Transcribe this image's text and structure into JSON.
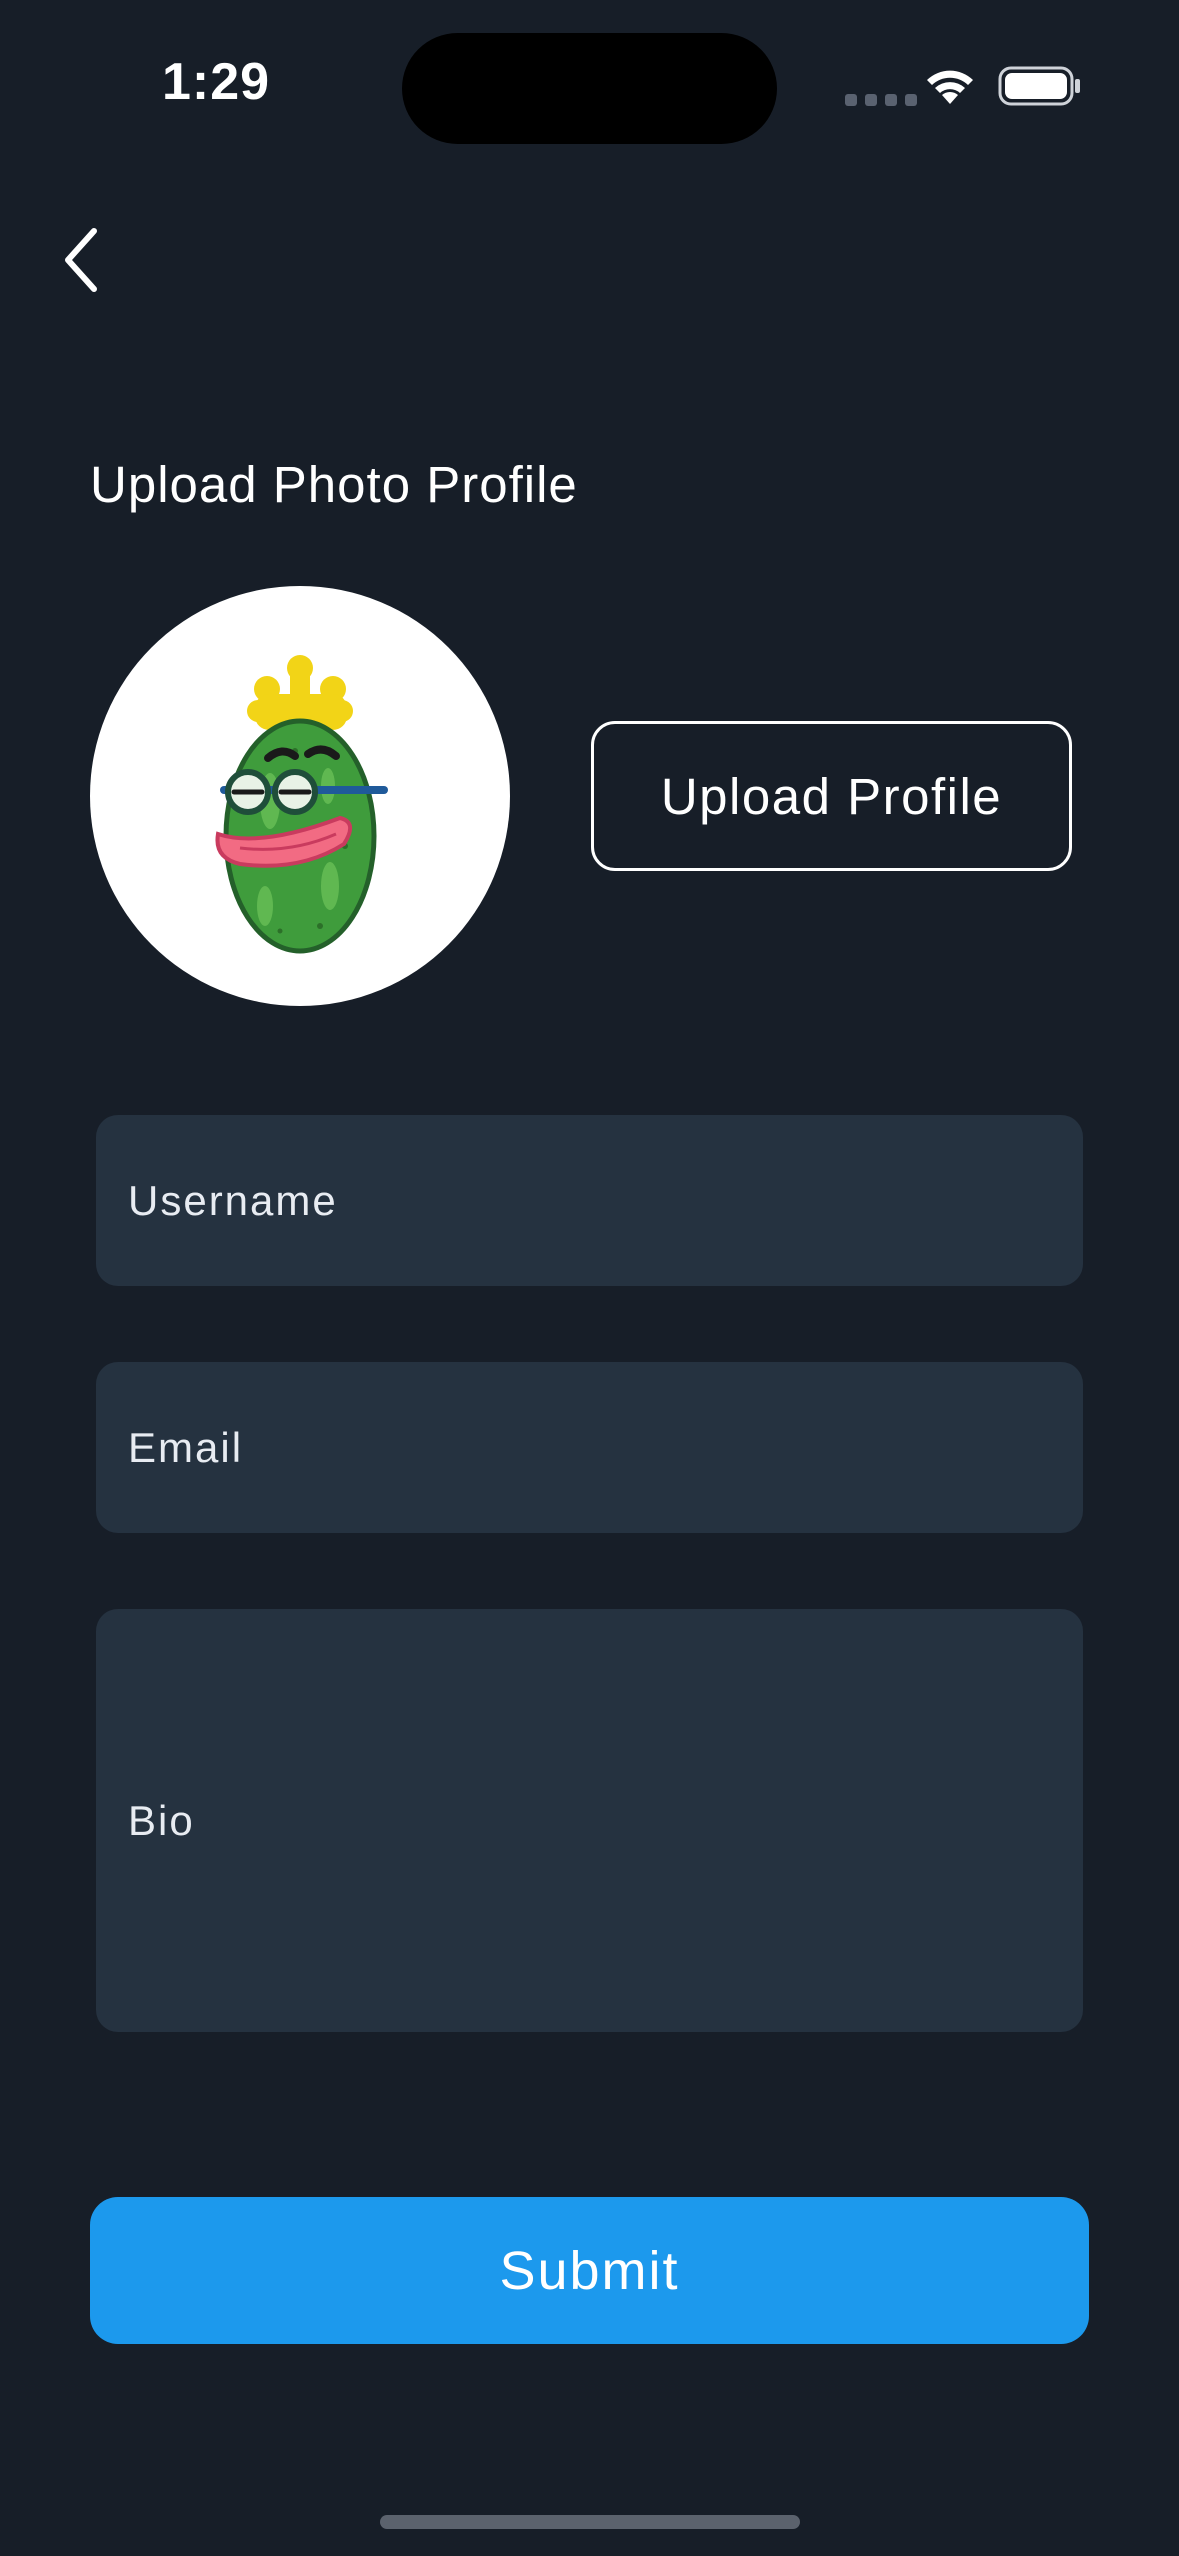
{
  "status_bar": {
    "time": "1:29"
  },
  "header": {
    "back_icon": "chevron-left-icon"
  },
  "profile": {
    "section_title": "Upload Photo Profile",
    "upload_button_label": "Upload Profile",
    "avatar_image": "cucumber-cartoon-character"
  },
  "form": {
    "username_placeholder": "Username",
    "email_placeholder": "Email",
    "bio_placeholder": "Bio",
    "submit_label": "Submit"
  },
  "colors": {
    "background": "#171e28",
    "field_background": "#253240",
    "accent": "#1c99ed"
  }
}
